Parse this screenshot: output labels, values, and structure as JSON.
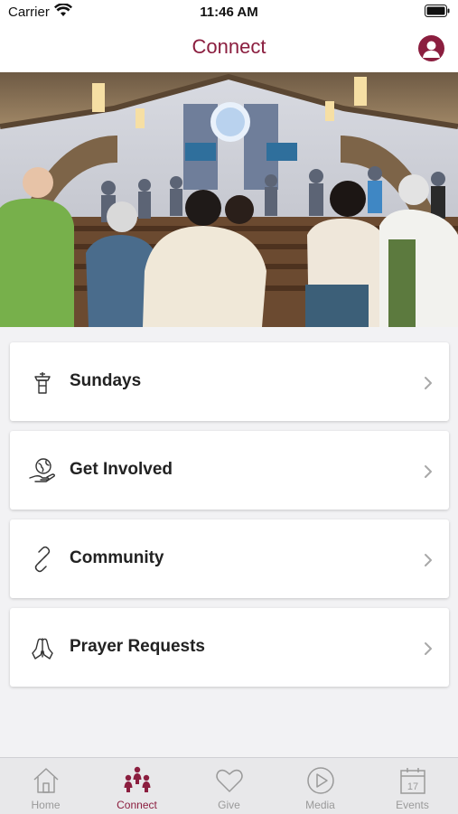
{
  "status_bar": {
    "carrier": "Carrier",
    "time": "11:46 AM"
  },
  "header": {
    "title": "Connect",
    "profile_icon": "profile-icon"
  },
  "hero": {
    "description_icon": "church-congregation-photo"
  },
  "menu": [
    {
      "label": "Sundays",
      "icon": "pulpit-icon"
    },
    {
      "label": "Get Involved",
      "icon": "globe-hand-icon"
    },
    {
      "label": "Community",
      "icon": "link-icon"
    },
    {
      "label": "Prayer Requests",
      "icon": "praying-hands-icon"
    }
  ],
  "tabs": [
    {
      "label": "Home",
      "icon": "home-icon",
      "active": false
    },
    {
      "label": "Connect",
      "icon": "people-icon",
      "active": true
    },
    {
      "label": "Give",
      "icon": "heart-icon",
      "active": false
    },
    {
      "label": "Media",
      "icon": "play-icon",
      "active": false
    },
    {
      "label": "Events",
      "icon": "calendar-icon",
      "active": false
    }
  ],
  "colors": {
    "accent": "#8b1e3f",
    "background": "#f2f2f4",
    "inactive": "#9a9a9a"
  }
}
